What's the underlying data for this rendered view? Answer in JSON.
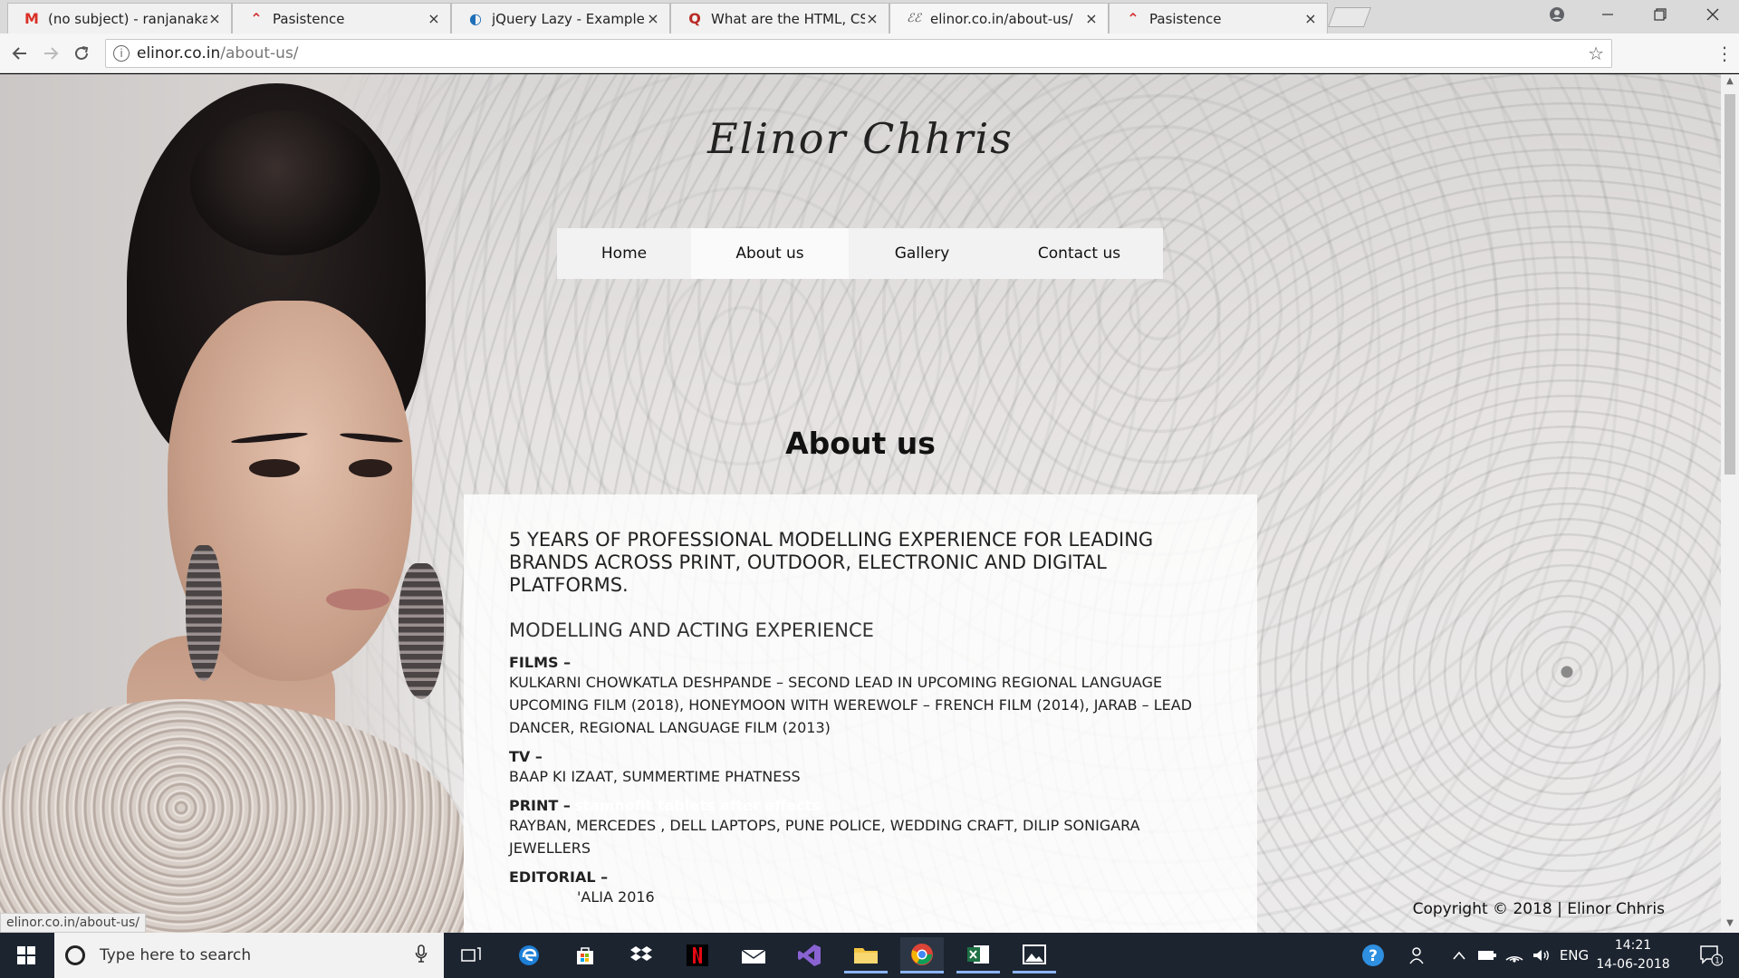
{
  "browser": {
    "tabs": [
      {
        "title": "(no subject) - ranjanakati",
        "favicon": "gmail-icon"
      },
      {
        "title": "Pasistence",
        "favicon": "pasistence-icon"
      },
      {
        "title": "jQuery Lazy - Example: M",
        "favicon": "jquery-icon"
      },
      {
        "title": "What are the HTML, CSS,",
        "favicon": "quora-icon"
      },
      {
        "title": "elinor.co.in/about-us/",
        "favicon": "elinor-icon"
      },
      {
        "title": "Pasistence",
        "favicon": "pasistence-icon"
      }
    ],
    "url_host": "elinor.co.in",
    "url_path": "/about-us/",
    "status_url": "elinor.co.in/about-us/",
    "tab_close_glyph": "×",
    "monogram": "ℰℰ"
  },
  "site": {
    "logo": "Elinor Chhris",
    "nav": [
      "Home",
      "About us",
      "Gallery",
      "Contact us"
    ],
    "active_nav": "About us",
    "page_title": "About us",
    "lead": "5 YEARS OF PROFESSIONAL MODELLING EXPERIENCE FOR LEADING BRANDS ACROSS PRINT, OUTDOOR, ELECTRONIC AND DIGITAL PLATFORMS.",
    "subheading": "MODELLING AND ACTING EXPERIENCE",
    "sections": [
      {
        "label": "FILMS  –",
        "text": "KULKARNI CHOWKATLA DESHPANDE – SECOND LEAD IN UPCOMING REGIONAL LANGUAGE UPCOMING FILM (2018), HONEYMOON WITH WEREWOLF – FRENCH FILM (2014), JARAB – LEAD DANCER, REGIONAL LANGUAGE FILM (2013)"
      },
      {
        "label": "TV –",
        "text": "BAAP KI IZAAT, SUMMERTIME PHATNESS"
      },
      {
        "label": "PRINT –",
        "ghost": "stamnofit tablets after effects",
        "text": "RAYBAN, MERCEDES , DELL LAPTOPS, PUNE POLICE, WEDDING CRAFT, DILIP SONIGARA JEWELLERS"
      },
      {
        "label": "EDITORIAL –",
        "text": "'ALIA 2016"
      }
    ],
    "copyright": "Copyright © 2018 | Elinor Chhris"
  },
  "taskbar": {
    "search_placeholder": "Type here to search",
    "language": "ENG",
    "time": "14:21",
    "date": "14-06-2018",
    "notification_count": "1",
    "apps": [
      "task-view-icon",
      "edge-icon",
      "store-icon",
      "dropbox-icon",
      "netflix-icon",
      "mail-icon",
      "visual-studio-icon",
      "file-explorer-icon",
      "chrome-icon",
      "excel-icon",
      "photos-icon"
    ]
  },
  "colors": {
    "taskbar_bg": "#1c2430",
    "nav_bg": "#f2f2f2",
    "gmail_red": "#d93025",
    "quora_red": "#b92b27",
    "chrome_blue": "#4285f4"
  }
}
